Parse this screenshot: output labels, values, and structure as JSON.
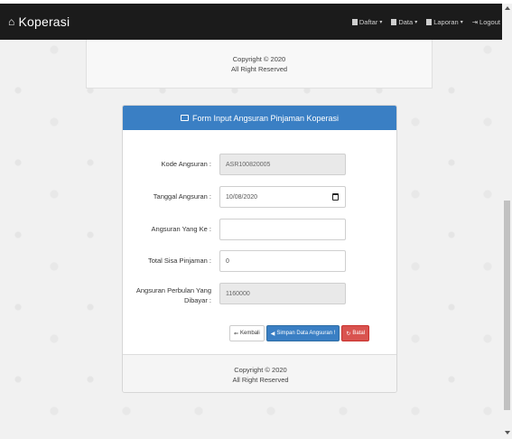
{
  "navbar": {
    "brand": "Koperasi",
    "items": [
      {
        "label": "Daftar"
      },
      {
        "label": "Data"
      },
      {
        "label": "Laporan"
      },
      {
        "label": "Logout"
      }
    ]
  },
  "footer_top": {
    "line1": "Copyright © 2020",
    "line2": "All Right Reserved"
  },
  "panel": {
    "title": "Form Input Angsuran Pinjaman Koperasi",
    "fields": {
      "kode": {
        "label": "Kode Angsuran :",
        "value": "ASR100820005"
      },
      "tanggal": {
        "label": "Tanggal Angsuran :",
        "value": "10/08/2020"
      },
      "angsuran_ke": {
        "label": "Angsuran Yang Ke :",
        "value": ""
      },
      "sisa": {
        "label": "Total Sisa Pinjaman :",
        "value": "0"
      },
      "perbulan": {
        "label_line1": "Angsuran Perbulan Yang",
        "label_line2": "Dibayar :",
        "value": "1160000"
      }
    },
    "buttons": {
      "back": "Kembali",
      "save": "Simpan Data Angsuran !",
      "cancel": "Batal"
    },
    "footer": {
      "line1": "Copyright © 2020",
      "line2": "All Right Reserved"
    }
  },
  "colors": {
    "navbar_bg": "#1b1b1b",
    "panel_header": "#3a7fc4",
    "danger": "#d9534f"
  }
}
